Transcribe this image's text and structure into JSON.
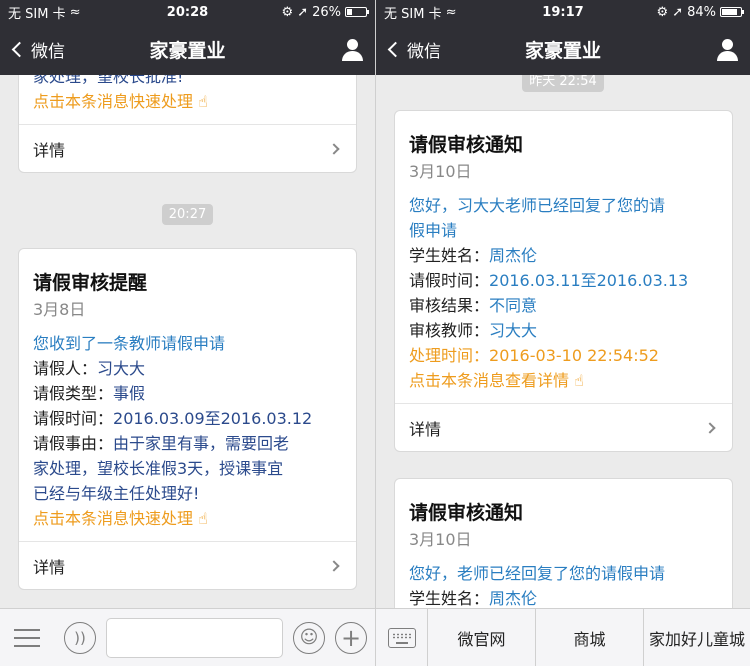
{
  "left": {
    "status": {
      "carrier": "无 SIM 卡",
      "time": "20:28",
      "battery": "26%",
      "battery_level": 0.26
    },
    "nav": {
      "back_label": "微信",
      "title": "家豪置业"
    },
    "partial_card": {
      "text_line": "家处理，望校长批准!",
      "action_text": "点击本条消息快速处理",
      "detail_label": "详情"
    },
    "timestamp": "20:27",
    "card": {
      "title": "请假审核提醒",
      "date": "3月8日",
      "intro": "您收到了一条教师请假申请",
      "applicant_key": "请假人：",
      "applicant": "习大大",
      "type_key": "请假类型：",
      "type": "事假",
      "time_key": "请假时间：",
      "time": "2016.03.09至2016.03.12",
      "reason_key": "请假事由：",
      "reason_1": "由于家里有事，需要回老",
      "reason_2": "家处理，望校长准假3天，授课事宜",
      "reason_3": "已经与年级主任处理好!",
      "action_text": "点击本条消息快速处理",
      "detail_label": "详情"
    }
  },
  "right": {
    "status": {
      "carrier": "无 SIM 卡",
      "time": "19:17",
      "battery": "84%",
      "battery_level": 0.84
    },
    "nav": {
      "back_label": "微信",
      "title": "家豪置业"
    },
    "timestamp_partial": "昨天 22:54",
    "card1": {
      "title": "请假审核通知",
      "date": "3月10日",
      "intro_1": "您好，习大大老师已经回复了您的请",
      "intro_2": "假申请",
      "student_key": "学生姓名：",
      "student": "周杰伦",
      "time_key": "请假时间：",
      "time": "2016.03.11至2016.03.13",
      "result_key": "审核结果：",
      "result": "不同意",
      "teacher_key": "审核教师：",
      "teacher": "习大大",
      "handled_key": "处理时间：",
      "handled": "2016-03-10 22:54:52",
      "action_text": "点击本条消息查看详情",
      "detail_label": "详情"
    },
    "card2": {
      "title": "请假审核通知",
      "date": "3月10日",
      "intro": "您好，老师已经回复了您的请假申请",
      "student_key": "学生姓名：",
      "student": "周杰伦"
    },
    "menu": [
      "微官网",
      "商城",
      "家加好儿童城"
    ]
  }
}
